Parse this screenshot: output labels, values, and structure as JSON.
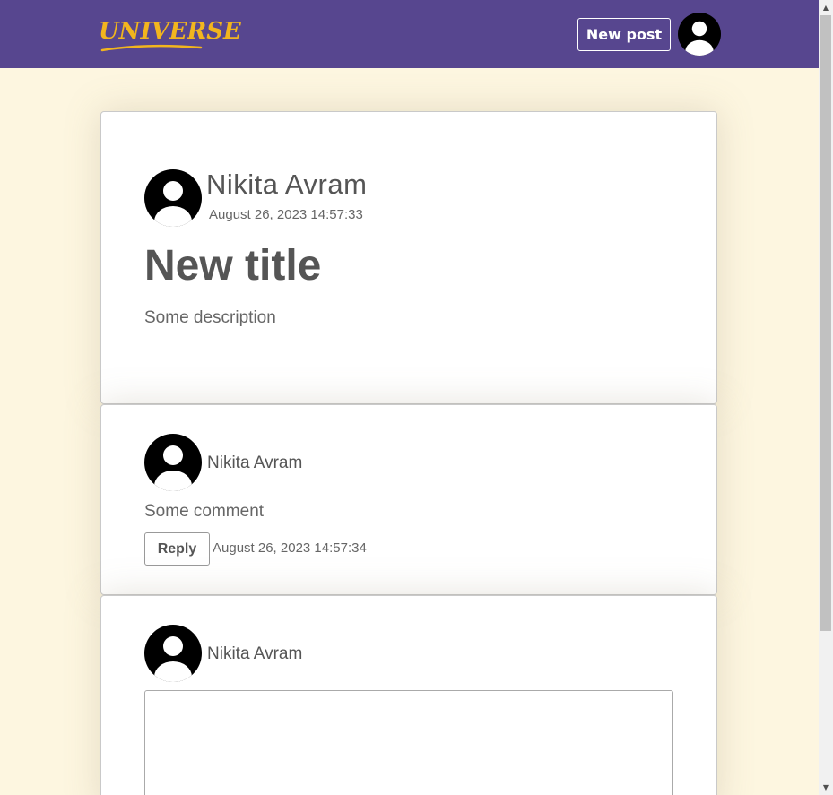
{
  "navbar": {
    "logo_text": "UNIVERSE",
    "new_post_label": "New post",
    "brand_color": "#57468f",
    "logo_color": "#f2b51e"
  },
  "post": {
    "author": "Nikita Avram",
    "date": "August 26, 2023 14:57:33",
    "title": "New title",
    "description": "Some description"
  },
  "comment": {
    "author": "Nikita Avram",
    "text": "Some comment",
    "reply_label": "Reply",
    "date": "August 26, 2023 14:57:34"
  },
  "reply_form": {
    "author": "Nikita Avram",
    "textarea_value": ""
  },
  "icons": {
    "avatar": "user-avatar-icon",
    "scroll_up": "scroll-up-arrow-icon",
    "scroll_down": "scroll-down-arrow-icon"
  },
  "colors": {
    "page_background": "#fdf6e0",
    "card_background": "#ffffff"
  }
}
